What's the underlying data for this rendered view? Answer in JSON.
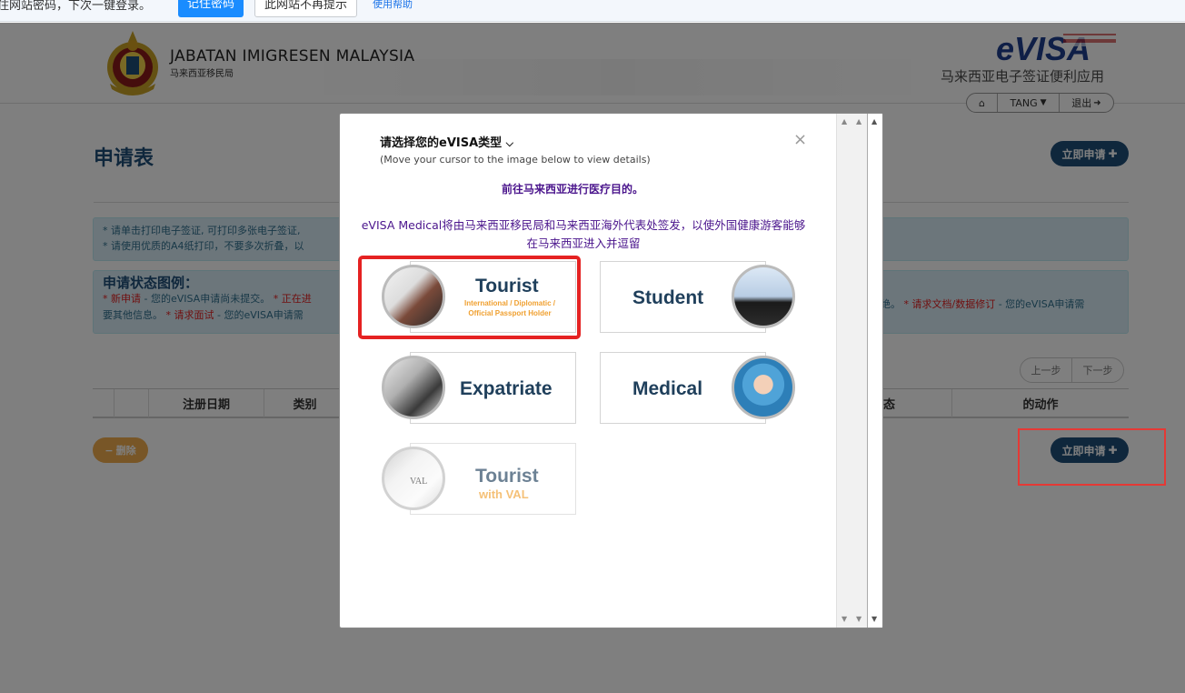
{
  "password_bar": {
    "message": "住网站密码，下次一键登录。",
    "remember_label": "记住密码",
    "never_label": "此网站不再提示",
    "help_label": "使用帮助"
  },
  "header": {
    "org_name": "JABATAN IMIGRESEN MALAYSIA",
    "org_sub": "马来西亚移民局",
    "logo_text": "eVISA",
    "app_name": "马来西亚电子签证便利应用",
    "nav": {
      "user_label": "TANG",
      "logout_label": "退出"
    }
  },
  "page": {
    "title": "申请表",
    "apply_label": "立即申请",
    "info_line1": "* 请单击打印电子签证, 可打印多张电子签证,",
    "info_line2": "* 请使用优质的A4纸打印，不要多次折叠，以",
    "legend_title": "申请状态图例：",
    "legend_new": "* 新申请",
    "legend_new_desc": " - 您的eVISA申请尚未提交。",
    "legend_progress": "* 正在进",
    "legend_line2_prefix": "要其他信息。",
    "legend_interview": "* 请求面试",
    "legend_interview_desc": " - 您的eVISA申请需",
    "legend_right_prefix": "绝。",
    "legend_revision": "* 请求文档/数据修订",
    "legend_revision_desc": " - 您的eVISA申请需",
    "pager": {
      "prev": "上一步",
      "next": "下一步"
    },
    "columns": [
      "注册日期",
      "类别",
      "态",
      "的动作"
    ],
    "delete_label": "删除"
  },
  "modal": {
    "title": "请选择您的eVISA类型",
    "hint": "(Move your cursor to the image below to view details)",
    "purpose": "前往马来西亚进行医疗目的。",
    "description": "eVISA Medical将由马来西亚移民局和马来西亚海外代表处签发，以使外国健康游客能够在马来西亚进入并逗留",
    "close": "×",
    "cards": [
      {
        "name": "Tourist",
        "sub1": "International / Diplomatic /",
        "sub2": "Official Passport Holder"
      },
      {
        "name": "Student"
      },
      {
        "name": "Expatriate"
      },
      {
        "name": "Medical"
      },
      {
        "name": "Tourist",
        "sub1": "with VAL",
        "image_text": "VAL"
      }
    ]
  },
  "colors": {
    "brand_navy": "#1f4e79",
    "accent_orange": "#f0a030",
    "highlight_red": "#e52222",
    "purple_text": "#4a148c"
  }
}
